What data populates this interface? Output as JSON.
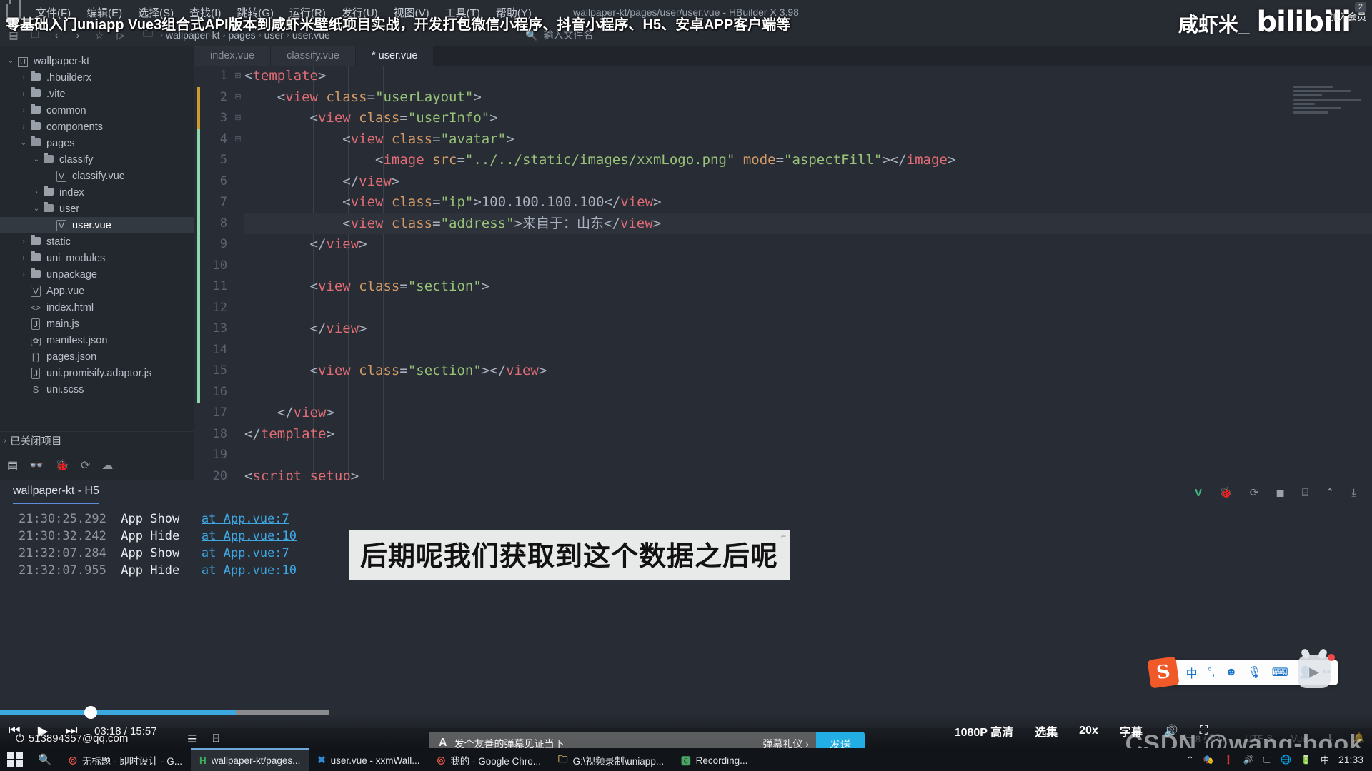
{
  "window": {
    "title": "wallpaper-kt/pages/user/user.vue - HBuilder X 3.98",
    "logo_icon": "hbuilder-logo-icon"
  },
  "menu": {
    "items": [
      "文件(F)",
      "编辑(E)",
      "选择(S)",
      "查找(I)",
      "跳转(G)",
      "运行(R)",
      "发行(U)",
      "视图(V)",
      "工具(T)",
      "帮助(Y)"
    ]
  },
  "toolbar": {
    "icons": [
      "panel-toggle-icon",
      "new-file-icon",
      "back-arrow-icon",
      "forward-arrow-icon",
      "star-icon",
      "run-icon",
      "project-icon"
    ],
    "breadcrumb": [
      "wallpaper-kt",
      "pages",
      "user",
      "user.vue"
    ],
    "filename_search_placeholder": "输入文件名",
    "filename_search_icon": "file-search-icon"
  },
  "overlay": {
    "video_title": "零基础入门uniapp Vue3组合式API版本到咸虾米壁纸项目实战，开发打包微信小程序、抖音小程序、H5、安卓APP客户端等",
    "channel_name": "咸虾米_",
    "site_logo": "bilibili",
    "top_right_line1": "加入会员",
    "top_right_badge": "2",
    "subtitle": "后期呢我们获取到这个数据之后呢",
    "watermark": "CSDN @wang-book",
    "email": "513894357@qq.com",
    "email_icon": "account-circle-icon"
  },
  "sidebar": {
    "tree": [
      {
        "label": "wallpaper-kt",
        "depth": 0,
        "arrow": "down",
        "icon": "project-icon",
        "selected": false
      },
      {
        "label": ".hbuilderx",
        "depth": 1,
        "arrow": "right",
        "icon": "folder-icon",
        "selected": false
      },
      {
        "label": ".vite",
        "depth": 1,
        "arrow": "right",
        "icon": "folder-icon",
        "selected": false
      },
      {
        "label": "common",
        "depth": 1,
        "arrow": "right",
        "icon": "folder-icon",
        "selected": false
      },
      {
        "label": "components",
        "depth": 1,
        "arrow": "right",
        "icon": "folder-icon",
        "selected": false
      },
      {
        "label": "pages",
        "depth": 1,
        "arrow": "down",
        "icon": "folder-open-icon",
        "selected": false
      },
      {
        "label": "classify",
        "depth": 2,
        "arrow": "down",
        "icon": "folder-open-icon",
        "selected": false
      },
      {
        "label": "classify.vue",
        "depth": 3,
        "arrow": "none",
        "icon": "vue-file-icon",
        "selected": false
      },
      {
        "label": "index",
        "depth": 2,
        "arrow": "right",
        "icon": "folder-icon",
        "selected": false
      },
      {
        "label": "user",
        "depth": 2,
        "arrow": "down",
        "icon": "folder-open-icon",
        "selected": false
      },
      {
        "label": "user.vue",
        "depth": 3,
        "arrow": "none",
        "icon": "vue-file-icon",
        "selected": true
      },
      {
        "label": "static",
        "depth": 1,
        "arrow": "right",
        "icon": "folder-icon",
        "selected": false
      },
      {
        "label": "uni_modules",
        "depth": 1,
        "arrow": "right",
        "icon": "folder-icon",
        "selected": false
      },
      {
        "label": "unpackage",
        "depth": 1,
        "arrow": "right",
        "icon": "folder-icon",
        "selected": false
      },
      {
        "label": "App.vue",
        "depth": 1,
        "arrow": "none",
        "icon": "vue-file-icon",
        "selected": false
      },
      {
        "label": "index.html",
        "depth": 1,
        "arrow": "none",
        "icon": "html-file-icon",
        "selected": false
      },
      {
        "label": "main.js",
        "depth": 1,
        "arrow": "none",
        "icon": "js-file-icon",
        "selected": false
      },
      {
        "label": "manifest.json",
        "depth": 1,
        "arrow": "none",
        "icon": "manifest-file-icon",
        "selected": false
      },
      {
        "label": "pages.json",
        "depth": 1,
        "arrow": "none",
        "icon": "json-file-icon",
        "selected": false
      },
      {
        "label": "uni.promisify.adaptor.js",
        "depth": 1,
        "arrow": "none",
        "icon": "js-file-icon",
        "selected": false
      },
      {
        "label": "uni.scss",
        "depth": 1,
        "arrow": "none",
        "icon": "scss-file-icon",
        "selected": false
      }
    ],
    "closed_projects_label": "已关闭项目",
    "tools": [
      "explorer-icon",
      "search-icon",
      "debug-icon",
      "terminal-share-icon",
      "cloud-icon"
    ]
  },
  "editor": {
    "tabs": [
      {
        "label": "index.vue",
        "active": false,
        "modified": false
      },
      {
        "label": "classify.vue",
        "active": false,
        "modified": false
      },
      {
        "label": "* user.vue",
        "active": true,
        "modified": true
      }
    ],
    "lines": [
      {
        "n": 1,
        "fold": "minus",
        "change": "none",
        "current": false,
        "tokens": [
          [
            "punc",
            "<"
          ],
          [
            "tag",
            "template"
          ],
          [
            "punc",
            ">"
          ]
        ]
      },
      {
        "n": 2,
        "fold": "minus",
        "change": "orange",
        "current": false,
        "tokens": [
          [
            "punc",
            "    <"
          ],
          [
            "tag",
            "view"
          ],
          [
            "attr",
            " class"
          ],
          [
            "punc",
            "="
          ],
          [
            "str",
            "\"userLayout\""
          ],
          [
            "punc",
            ">"
          ]
        ]
      },
      {
        "n": 3,
        "fold": "minus",
        "change": "orange",
        "current": false,
        "tokens": [
          [
            "punc",
            "        <"
          ],
          [
            "tag",
            "view"
          ],
          [
            "attr",
            " class"
          ],
          [
            "punc",
            "="
          ],
          [
            "str",
            "\"userInfo\""
          ],
          [
            "punc",
            ">"
          ]
        ]
      },
      {
        "n": 4,
        "fold": "minus",
        "change": "green",
        "current": false,
        "tokens": [
          [
            "punc",
            "            <"
          ],
          [
            "tag",
            "view"
          ],
          [
            "attr",
            " class"
          ],
          [
            "punc",
            "="
          ],
          [
            "str",
            "\"avatar\""
          ],
          [
            "punc",
            ">"
          ]
        ]
      },
      {
        "n": 5,
        "fold": "none",
        "change": "green",
        "current": false,
        "tokens": [
          [
            "punc",
            "                <"
          ],
          [
            "tag",
            "image"
          ],
          [
            "attr",
            " src"
          ],
          [
            "punc",
            "="
          ],
          [
            "str",
            "\"../../static/images/xxmLogo.png\""
          ],
          [
            "attr",
            " mode"
          ],
          [
            "punc",
            "="
          ],
          [
            "str",
            "\"aspectFill\""
          ],
          [
            "punc",
            "></"
          ],
          [
            "tag",
            "image"
          ],
          [
            "punc",
            ">"
          ]
        ]
      },
      {
        "n": 6,
        "fold": "none",
        "change": "green",
        "current": false,
        "tokens": [
          [
            "punc",
            "            </"
          ],
          [
            "tag",
            "view"
          ],
          [
            "punc",
            ">"
          ]
        ]
      },
      {
        "n": 7,
        "fold": "none",
        "change": "green",
        "current": false,
        "tokens": [
          [
            "punc",
            "            <"
          ],
          [
            "tag",
            "view"
          ],
          [
            "attr",
            " class"
          ],
          [
            "punc",
            "="
          ],
          [
            "str",
            "\"ip\""
          ],
          [
            "punc",
            ">"
          ],
          [
            "txt",
            "100.100.100.100"
          ],
          [
            "punc",
            "</"
          ],
          [
            "tag",
            "view"
          ],
          [
            "punc",
            ">"
          ]
        ]
      },
      {
        "n": 8,
        "fold": "none",
        "change": "green",
        "current": true,
        "tokens": [
          [
            "punc",
            "            <"
          ],
          [
            "tag",
            "view"
          ],
          [
            "attr",
            " class"
          ],
          [
            "punc",
            "="
          ],
          [
            "str",
            "\"address\""
          ],
          [
            "punc",
            ">"
          ],
          [
            "txt",
            "来自于：山东"
          ],
          [
            "punc",
            "</"
          ],
          [
            "tag",
            "view"
          ],
          [
            "punc",
            ">"
          ]
        ]
      },
      {
        "n": 9,
        "fold": "none",
        "change": "green",
        "current": false,
        "tokens": [
          [
            "punc",
            "        </"
          ],
          [
            "tag",
            "view"
          ],
          [
            "punc",
            ">"
          ]
        ]
      },
      {
        "n": 10,
        "fold": "none",
        "change": "green",
        "current": false,
        "tokens": []
      },
      {
        "n": 11,
        "fold": "none",
        "change": "green",
        "current": false,
        "tokens": [
          [
            "punc",
            "        <"
          ],
          [
            "tag",
            "view"
          ],
          [
            "attr",
            " class"
          ],
          [
            "punc",
            "="
          ],
          [
            "str",
            "\"section\""
          ],
          [
            "punc",
            ">"
          ]
        ]
      },
      {
        "n": 12,
        "fold": "none",
        "change": "green",
        "current": false,
        "tokens": []
      },
      {
        "n": 13,
        "fold": "none",
        "change": "green",
        "current": false,
        "tokens": [
          [
            "punc",
            "        </"
          ],
          [
            "tag",
            "view"
          ],
          [
            "punc",
            ">"
          ]
        ]
      },
      {
        "n": 14,
        "fold": "none",
        "change": "green",
        "current": false,
        "tokens": []
      },
      {
        "n": 15,
        "fold": "none",
        "change": "green",
        "current": false,
        "tokens": [
          [
            "punc",
            "        <"
          ],
          [
            "tag",
            "view"
          ],
          [
            "attr",
            " class"
          ],
          [
            "punc",
            "="
          ],
          [
            "str",
            "\"section\""
          ],
          [
            "punc",
            "></"
          ],
          [
            "tag",
            "view"
          ],
          [
            "punc",
            ">"
          ]
        ]
      },
      {
        "n": 16,
        "fold": "none",
        "change": "green",
        "current": false,
        "tokens": []
      },
      {
        "n": 17,
        "fold": "none",
        "change": "none",
        "current": false,
        "tokens": [
          [
            "punc",
            "    </"
          ],
          [
            "tag",
            "view"
          ],
          [
            "punc",
            ">"
          ]
        ]
      },
      {
        "n": 18,
        "fold": "none",
        "change": "none",
        "current": false,
        "tokens": [
          [
            "punc",
            "</"
          ],
          [
            "tag",
            "template"
          ],
          [
            "punc",
            ">"
          ]
        ]
      },
      {
        "n": 19,
        "fold": "none",
        "change": "none",
        "current": false,
        "tokens": []
      },
      {
        "n": 20,
        "fold": "none",
        "change": "none",
        "current": false,
        "tokens": [
          [
            "punc",
            "<"
          ],
          [
            "tag",
            "script setup"
          ],
          [
            "punc",
            ">"
          ]
        ]
      }
    ]
  },
  "console": {
    "tab_label": "wallpaper-kt - H5",
    "icons": [
      "vue-devtools-icon",
      "bug-icon",
      "restart-icon",
      "stop-icon",
      "terminal-add-icon",
      "collapse-icon",
      "clear-icon"
    ],
    "logs": [
      {
        "time": "21:30:25.292",
        "msg": "App Show",
        "src": "at App.vue:7"
      },
      {
        "time": "21:30:32.242",
        "msg": "App Hide",
        "src": "at App.vue:10"
      },
      {
        "time": "21:32:07.284",
        "msg": "App Show",
        "src": "at App.vue:7"
      },
      {
        "time": "21:32:07.955",
        "msg": "App Hide",
        "src": "at App.vue:10"
      }
    ]
  },
  "statusbar": {
    "line_col": "行:8  列:41",
    "encoding": "UTF-8",
    "language": "Vue",
    "icons": [
      "download-icon",
      "bell-icon"
    ]
  },
  "player": {
    "prev_icon": "skip-previous-icon",
    "play_icon": "play-icon",
    "next_icon": "skip-next-icon",
    "time": "03:18 / 15:57",
    "quality": "1080P 高清",
    "episodes": "选集",
    "speed": "20x",
    "subtitle_btn": "字幕",
    "volume_icon": "volume-icon",
    "widescreen_icon": "widescreen-icon",
    "danmu_placeholder": "发个友善的弹幕见证当下",
    "danmu_etiquette": "弹幕礼仪 ›",
    "danmu_send": "发送",
    "progress_percent": 21
  },
  "taskbar": {
    "start_icon": "windows-start-icon",
    "search_icon": "search-icon",
    "items": [
      {
        "label": "无标题 - 即时设计 - G...",
        "icon": "chrome-icon",
        "active": false
      },
      {
        "label": "wallpaper-kt/pages...",
        "icon": "hbuilder-icon",
        "active": true
      },
      {
        "label": "user.vue - xxmWall...",
        "icon": "vscode-icon",
        "active": false
      },
      {
        "label": "我的 - Google Chro...",
        "icon": "chrome-icon",
        "active": false
      },
      {
        "label": "G:\\视频录制\\uniapp...",
        "icon": "folder-icon",
        "active": false
      },
      {
        "label": "Recording...",
        "icon": "camtasia-icon",
        "active": false
      }
    ],
    "tray": [
      "chevron-up-icon",
      "app-icon",
      "warning-icon",
      "volume-icon",
      "display-icon",
      "ime-icon",
      "net-icon",
      "battery-icon",
      "ime-zh-icon"
    ],
    "clock": "21:33"
  },
  "ime": {
    "brand": "S",
    "mode": "中",
    "items": [
      "punctuation-icon",
      "emoji-icon",
      "mic-icon",
      "keyboard-icon",
      "user-icon",
      "grid-icon"
    ]
  },
  "colors": {
    "accent": "#23ade5",
    "editor_bg": "#282c34",
    "sidebar_bg": "#23272e",
    "tag": "#e06c75",
    "attr": "#d19a66",
    "string": "#98c379",
    "link": "#3ea8e5"
  }
}
